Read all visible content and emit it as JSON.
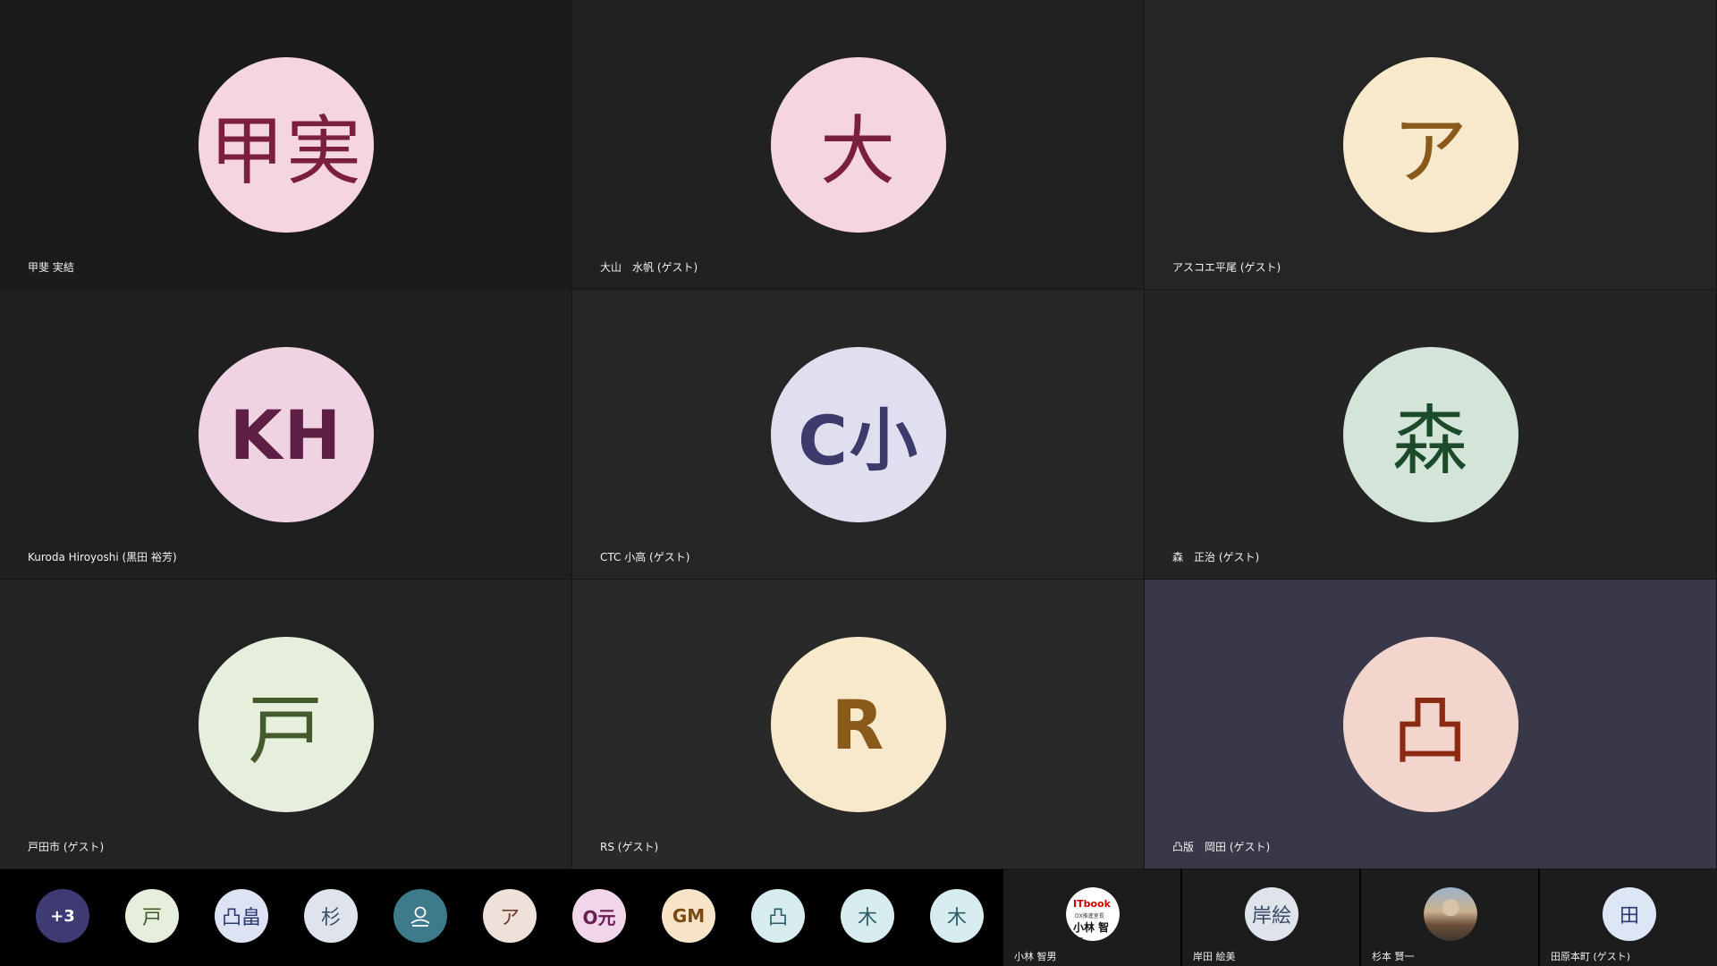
{
  "tiles": [
    {
      "initials": "甲実",
      "name": "甲斐 実結",
      "bg": "#f5d5de",
      "fg": "#7a1f3d",
      "latin": false
    },
    {
      "initials": "大",
      "name": "大山　水帆 (ゲスト)",
      "bg": "#f5d5de",
      "fg": "#7a1f3d",
      "latin": false
    },
    {
      "initials": "ア",
      "name": "アスコエ平尾 (ゲスト)",
      "bg": "#f8e9cc",
      "fg": "#8a5a1a",
      "latin": false
    },
    {
      "initials": "KH",
      "name": "Kuroda Hiroyoshi (黒田 裕芳)",
      "bg": "#efd3e2",
      "fg": "#5e1f45",
      "latin": true
    },
    {
      "initials": "C小",
      "name": "CTC 小高 (ゲスト)",
      "bg": "#e0dff0",
      "fg": "#3c3b6b",
      "latin": true
    },
    {
      "initials": "森",
      "name": "森　正治 (ゲスト)",
      "bg": "#d2e5d8",
      "fg": "#1e4a2c",
      "latin": false
    },
    {
      "initials": "戸",
      "name": "戸田市 (ゲスト)",
      "bg": "#e6efdc",
      "fg": "#455a2c",
      "latin": false
    },
    {
      "initials": "R",
      "name": "RS (ゲスト)",
      "bg": "#f8e9cc",
      "fg": "#8a5a1a",
      "latin": true
    },
    {
      "initials": "凸",
      "name": "凸版　岡田 (ゲスト)",
      "bg": "#f2d5cc",
      "fg": "#8a2a12",
      "latin": false
    }
  ],
  "strip": [
    {
      "text": "+3",
      "bg": "#3d3b72",
      "fg": "#ffffff",
      "kind": "more"
    },
    {
      "text": "戸",
      "bg": "#e6efdc",
      "fg": "#455a2c",
      "kind": "cjk"
    },
    {
      "text": "凸畠",
      "bg": "#dde3f5",
      "fg": "#2c3a70",
      "kind": "cjk"
    },
    {
      "text": "杉",
      "bg": "#dfe3ec",
      "fg": "#3a4a66",
      "kind": "cjk"
    },
    {
      "text": "person-icon",
      "bg": "#3d7a8a",
      "fg": "#ffffff",
      "kind": "icon"
    },
    {
      "text": "ア",
      "bg": "#efe0da",
      "fg": "#6a4030",
      "kind": "cjk"
    },
    {
      "text": "O元",
      "bg": "#f1d5e8",
      "fg": "#6a1f55",
      "kind": "latin"
    },
    {
      "text": "GM",
      "bg": "#f8e5c9",
      "fg": "#7a4a12",
      "kind": "latin"
    },
    {
      "text": "凸",
      "bg": "#d7ecef",
      "fg": "#2c5a66",
      "kind": "cjk"
    },
    {
      "text": "木",
      "bg": "#d7ecef",
      "fg": "#2c5a66",
      "kind": "cjk"
    },
    {
      "text": "木",
      "bg": "#d7ecef",
      "fg": "#2c5a66",
      "kind": "cjk"
    }
  ],
  "pinned": [
    {
      "name": "小林 智男",
      "kind": "badge",
      "badge_top": "ITbook",
      "badge_mid": "DX推進室長",
      "badge_bot": "小林 智男"
    },
    {
      "name": "岸田 絵美",
      "kind": "initials",
      "initials": "岸絵",
      "bg": "#dfe3ec",
      "fg": "#3a4a66"
    },
    {
      "name": "杉本 賢一",
      "kind": "photo"
    },
    {
      "name": "田原本町 (ゲスト)",
      "kind": "initials",
      "initials": "田",
      "bg": "#dde6f5",
      "fg": "#2c3a70"
    }
  ]
}
